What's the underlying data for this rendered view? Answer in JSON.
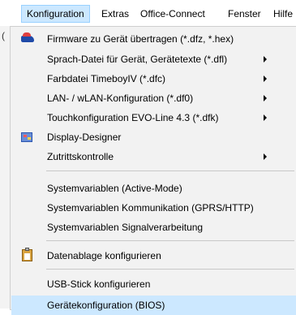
{
  "menubar": {
    "items": [
      {
        "label": "Konfiguration"
      },
      {
        "label": "Extras"
      },
      {
        "label": "Office-Connect"
      },
      {
        "label": "Fenster"
      },
      {
        "label": "Hilfe"
      }
    ]
  },
  "background": {
    "left_char": "("
  },
  "menu": {
    "items": [
      {
        "label": "Firmware zu Gerät übertragen (*.dfz, *.hex)",
        "icon": "firmware-transfer-icon"
      },
      {
        "label": "Sprach-Datei für Gerät, Gerätetexte (*.dfl)",
        "submenu": true
      },
      {
        "label": "Farbdatei TimeboyIV (*.dfc)",
        "submenu": true
      },
      {
        "label": "LAN- / wLAN-Konfiguration (*.df0)",
        "submenu": true
      },
      {
        "label": "Touchkonfiguration EVO-Line 4.3 (*.dfk)",
        "submenu": true
      },
      {
        "label": "Display-Designer",
        "icon": "display-designer-icon"
      },
      {
        "label": "Zutrittskontrolle",
        "submenu": true
      },
      {
        "label": "Systemvariablen (Active-Mode)"
      },
      {
        "label": "Systemvariablen Kommunikation (GPRS/HTTP)"
      },
      {
        "label": "Systemvariablen Signalverarbeitung"
      },
      {
        "label": "Datenablage konfigurieren",
        "icon": "clipboard-icon"
      },
      {
        "label": "USB-Stick konfigurieren"
      },
      {
        "label": "Gerätekonfiguration (BIOS)",
        "highlighted": true
      }
    ]
  },
  "colors": {
    "menu_active": "#cce8ff",
    "hover": "#cce8ff",
    "menu_bg": "#f2f2f2",
    "separator": "#c8c8c8"
  }
}
